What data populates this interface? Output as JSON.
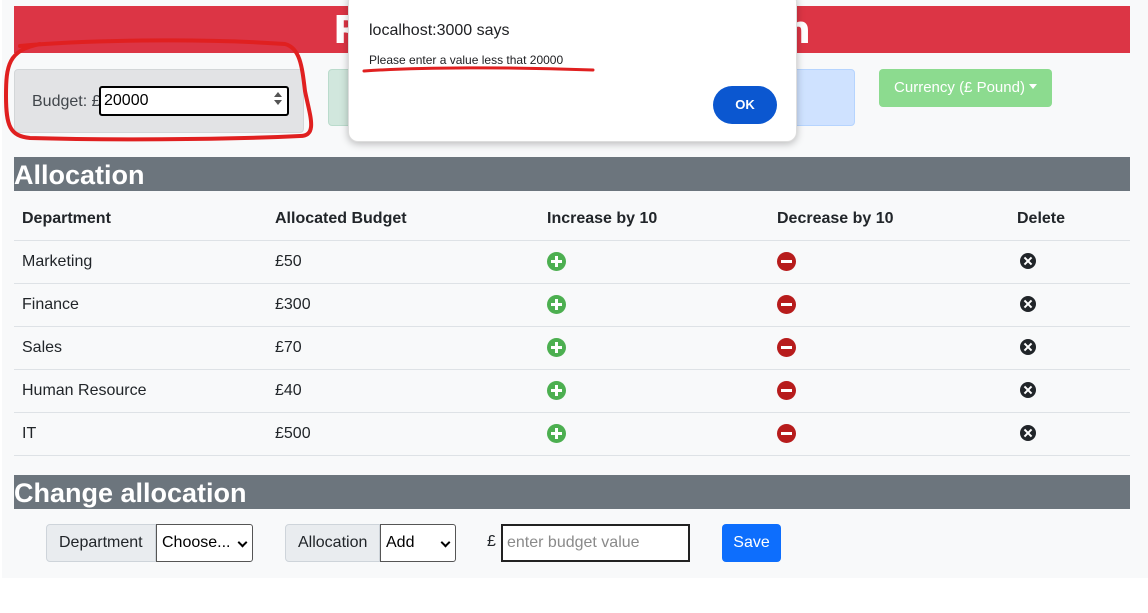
{
  "header": {
    "title": "RKL Budget Allocation"
  },
  "budget": {
    "label": "Budget: £",
    "value": "20000"
  },
  "currency_dropdown": {
    "label": "Currency (£ Pound)"
  },
  "alert": {
    "title": "localhost:3000 says",
    "message": "Please enter a value less that 20000",
    "ok_label": "OK"
  },
  "allocation": {
    "heading": "Allocation",
    "columns": [
      "Department",
      "Allocated Budget",
      "Increase by 10",
      "Decrease by 10",
      "Delete"
    ],
    "rows": [
      {
        "department": "Marketing",
        "budget": "£50"
      },
      {
        "department": "Finance",
        "budget": "£300"
      },
      {
        "department": "Sales",
        "budget": "£70"
      },
      {
        "department": "Human Resource",
        "budget": "£40"
      },
      {
        "department": "IT",
        "budget": "£500"
      }
    ]
  },
  "change_allocation": {
    "heading": "Change allocation",
    "department_label": "Department",
    "department_selected": "Choose...",
    "allocation_label": "Allocation",
    "allocation_selected": "Add",
    "currency_symbol": "£",
    "budget_placeholder": "enter budget value",
    "save_label": "Save"
  },
  "colors": {
    "title_bar": "#dc3545",
    "section_bar": "#6c757d",
    "increase_icon": "#4caf50",
    "decrease_icon": "#b71c1c",
    "save_button": "#0d6efd",
    "annotation_red": "#e02020"
  }
}
